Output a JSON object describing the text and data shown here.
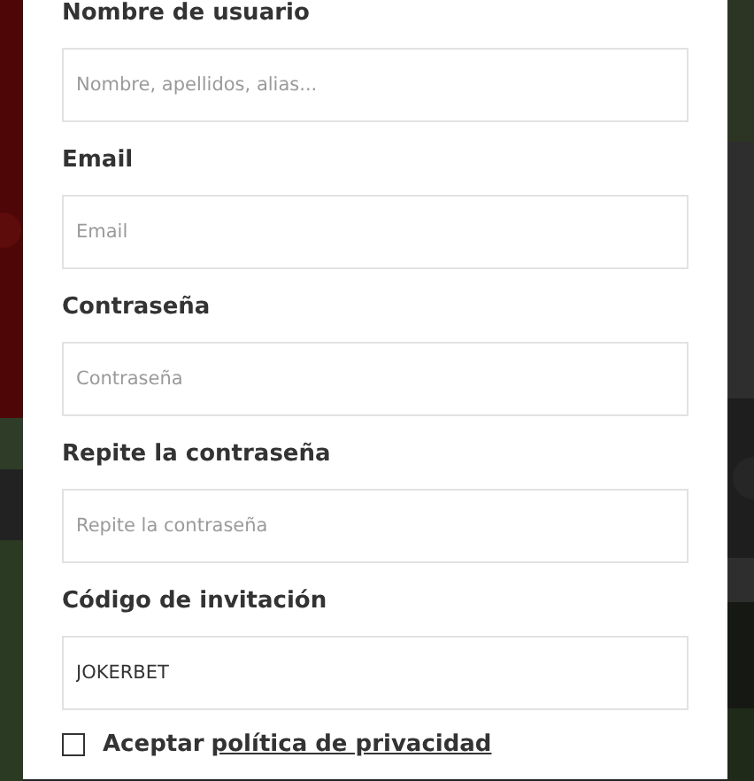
{
  "fields": [
    {
      "label": "Nombre de usuario",
      "placeholder": "Nombre, apellidos, alias..."
    },
    {
      "label": "Email",
      "placeholder": "Email"
    },
    {
      "label": "Contraseña",
      "placeholder": "Contraseña"
    },
    {
      "label": "Repite la contraseña",
      "placeholder": "Repite la contraseña"
    },
    {
      "label": "Código de invitación",
      "value": "JOKERBET"
    }
  ],
  "privacy": {
    "checked": false,
    "label": "Aceptar",
    "link": "política de privacidad"
  }
}
